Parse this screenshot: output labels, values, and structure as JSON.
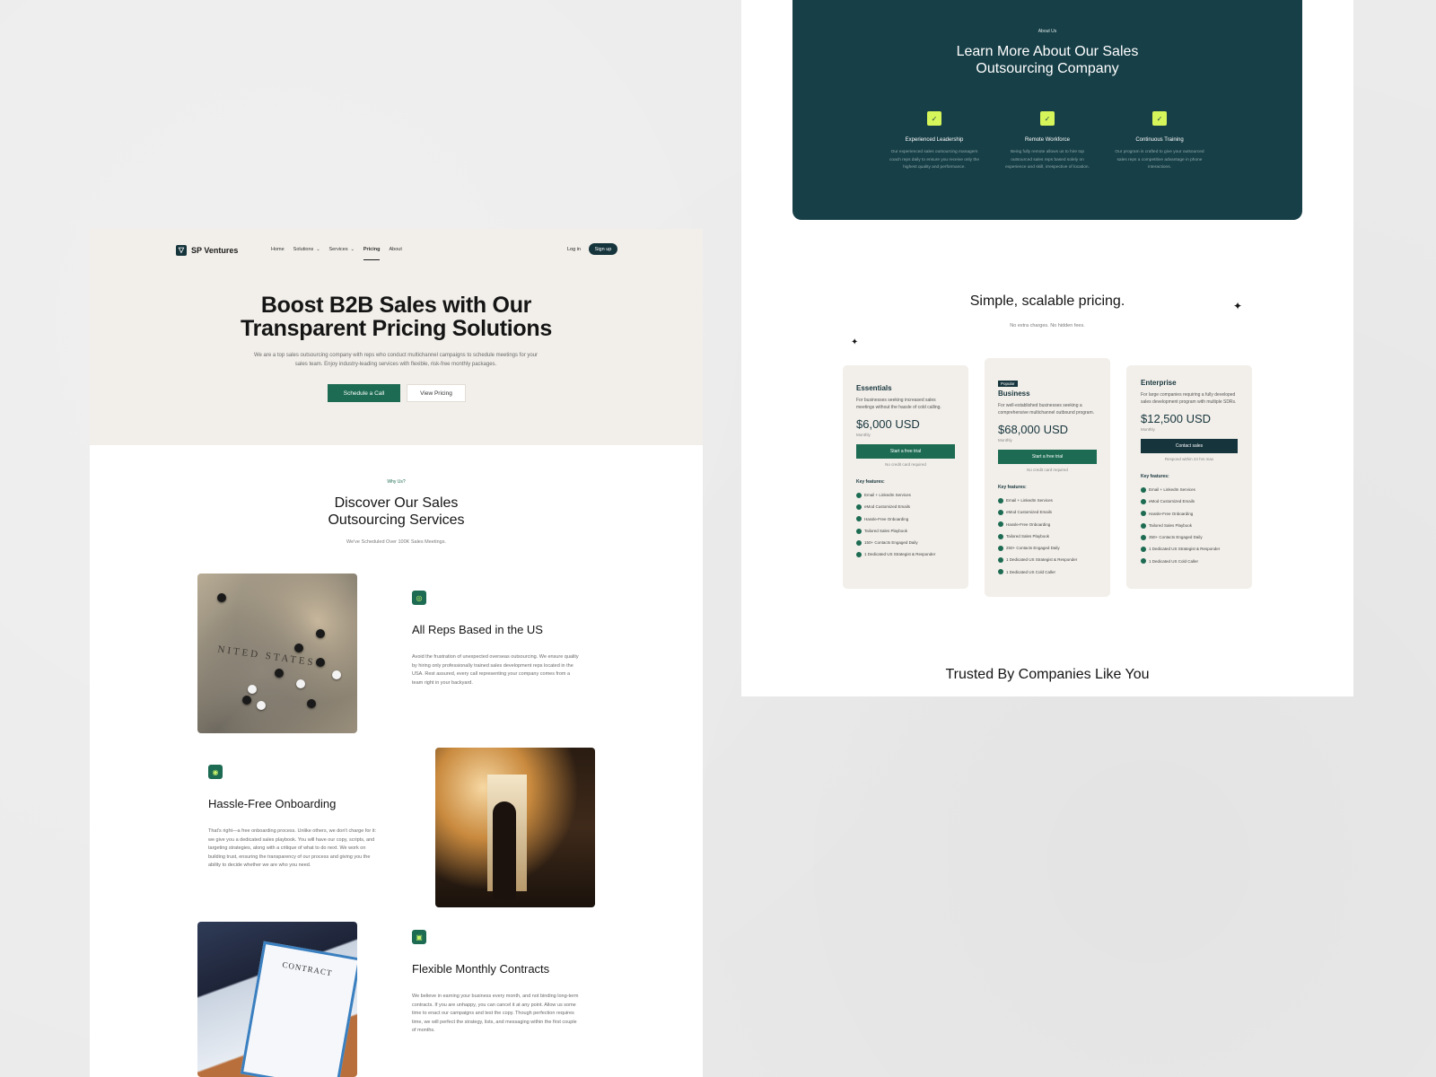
{
  "nav": {
    "brand": "SP Ventures",
    "links": [
      "Home",
      "Solutions",
      "Services",
      "Pricing",
      "About"
    ],
    "login": "Log in",
    "signup": "Sign up"
  },
  "hero": {
    "title_line1": "Boost B2B Sales with Our",
    "title_line2": "Transparent Pricing Solutions",
    "desc": "We are a top sales outsourcing company with reps who conduct multichannel campaigns to schedule meetings for your sales team. Enjoy industry-leading services with flexible, risk-free monthly packages.",
    "primary": "Schedule a Call",
    "secondary": "View Pricing"
  },
  "why": {
    "tag": "Why Us?",
    "title_line1": "Discover Our Sales",
    "title_line2": "Outsourcing Services",
    "sub": "We've Scheduled Over 100K Sales Meetings."
  },
  "features": [
    {
      "title": "All Reps Based in the US",
      "desc": "Avoid the frustration of unexpected overseas outsourcing. We ensure quality by hiring only professionally trained sales development reps located in the USA. Rest assured, every call representing your company comes from a team right in your backyard."
    },
    {
      "title": "Hassle-Free Onboarding",
      "desc": "That's right—a free onboarding process. Unlike others, we don't charge for it: we give you a dedicated sales playbook. You will have our copy, scripts, and targeting strategies, along with a critique of what to do next. We work on building trust, ensuring the transparency of our process and giving you the ability to decide whether we are who you need."
    },
    {
      "title": "Flexible Monthly Contracts",
      "desc": "We believe in earning your business every month, and not binding long-term contracts. If you are unhappy, you can cancel it at any point. Allow us some time to enact our campaigns and test the copy. Though perfection requires time, we will perfect the strategy, lists, and messaging within the first couple of months."
    }
  ],
  "photos": {
    "map_label": "NITED STATES",
    "contract_label": "CONTRACT"
  },
  "about": {
    "tag": "About Us",
    "title_line1": "Learn More About Our Sales",
    "title_line2": "Outsourcing Company",
    "items": [
      {
        "title": "Experienced Leadership",
        "desc": "Our experienced sales outsourcing managers coach reps daily to ensure you receive only the highest quality and performance."
      },
      {
        "title": "Remote Workforce",
        "desc": "Being fully remote allows us to hire top outsourced sales reps based solely on experience and skill, irrespective of location."
      },
      {
        "title": "Continuous Training",
        "desc": "Our program is crafted to give your outsourced sales reps a competitive advantage in phone interactions."
      }
    ]
  },
  "pricing": {
    "title": "Simple, scalable pricing.",
    "sub": "No extra charges. No hidden fees.",
    "plans": [
      {
        "name": "Essentials",
        "badge": "",
        "desc": "For businesses seeking increased sales meetings without the hassle of cold calling.",
        "price": "$6,000 USD",
        "per": "Monthly",
        "cta": "Start a free trial",
        "note": "No credit card required",
        "kf": "Key features:",
        "features": [
          "Email + LinkedIn Services",
          "eMod Customized Emails",
          "Hassle-Free Onboarding",
          "Tailored Sales Playbook",
          "150+ Contacts Engaged Daily",
          "1 Dedicated US Strategist & Responder"
        ]
      },
      {
        "name": "Business",
        "badge": "Popular",
        "desc": "For well-established businesses seeking a comprehensive multichannel outbound program.",
        "price": "$68,000 USD",
        "per": "Monthly",
        "cta": "Start a free trial",
        "note": "No credit card required",
        "kf": "Key features:",
        "features": [
          "Email + LinkedIn Services",
          "eMod Customized Emails",
          "Hassle-Free Onboarding",
          "Tailored Sales Playbook",
          "250+ Contacts Engaged Daily",
          "1 Dedicated US Strategist & Responder",
          "1 Dedicated US Cold Caller"
        ]
      },
      {
        "name": "Enterprise",
        "badge": "",
        "desc": "For large companies requiring a fully developed sales development program with multiple SDRs.",
        "price": "$12,500 USD",
        "per": "Monthly",
        "cta": "Contact sales",
        "note": "Respond within 24 hrs max",
        "kf": "Key features:",
        "features": [
          "Email + LinkedIn Services",
          "eMod Customized Emails",
          "Hassle-Free Onboarding",
          "Tailored Sales Playbook",
          "350+ Contacts Engaged Daily",
          "1 Dedicated US Strategist & Responder",
          "1 Dedicated US Cold Caller"
        ]
      }
    ]
  },
  "trusted": "Trusted By Companies Like You",
  "icons": {
    "logo": "logo-v-icon",
    "feature": "feature-icon",
    "about": "checkmark-icon",
    "check": "check-icon",
    "sparkle": "sparkle-icon"
  }
}
